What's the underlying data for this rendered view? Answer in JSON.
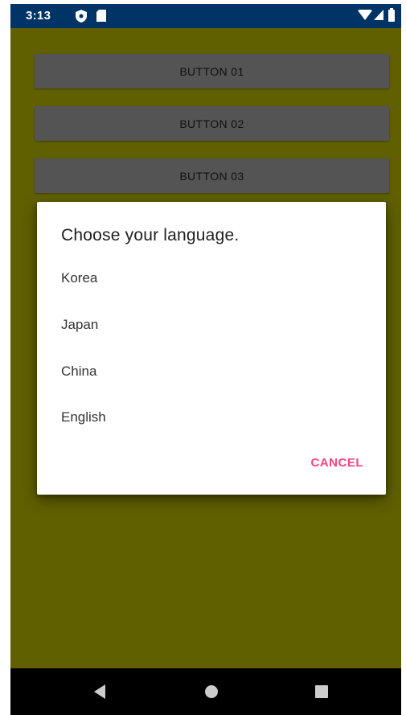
{
  "status_bar": {
    "time": "3:13",
    "icons": [
      "shield-icon",
      "sd-card-icon",
      "wifi-icon",
      "signal-icon",
      "battery-icon"
    ],
    "background": "#003366"
  },
  "app": {
    "background": "#666600",
    "buttons": [
      {
        "label": "BUTTON 01"
      },
      {
        "label": "BUTTON 02"
      },
      {
        "label": "BUTTON 03"
      }
    ]
  },
  "dialog": {
    "title": "Choose your language.",
    "items": [
      {
        "label": "Korea"
      },
      {
        "label": "Japan"
      },
      {
        "label": "China"
      },
      {
        "label": "English"
      }
    ],
    "cancel_label": "CANCEL",
    "accent_color": "#ff4081"
  },
  "nav_bar": {
    "icons": [
      "back-icon",
      "home-icon",
      "recents-icon"
    ]
  }
}
